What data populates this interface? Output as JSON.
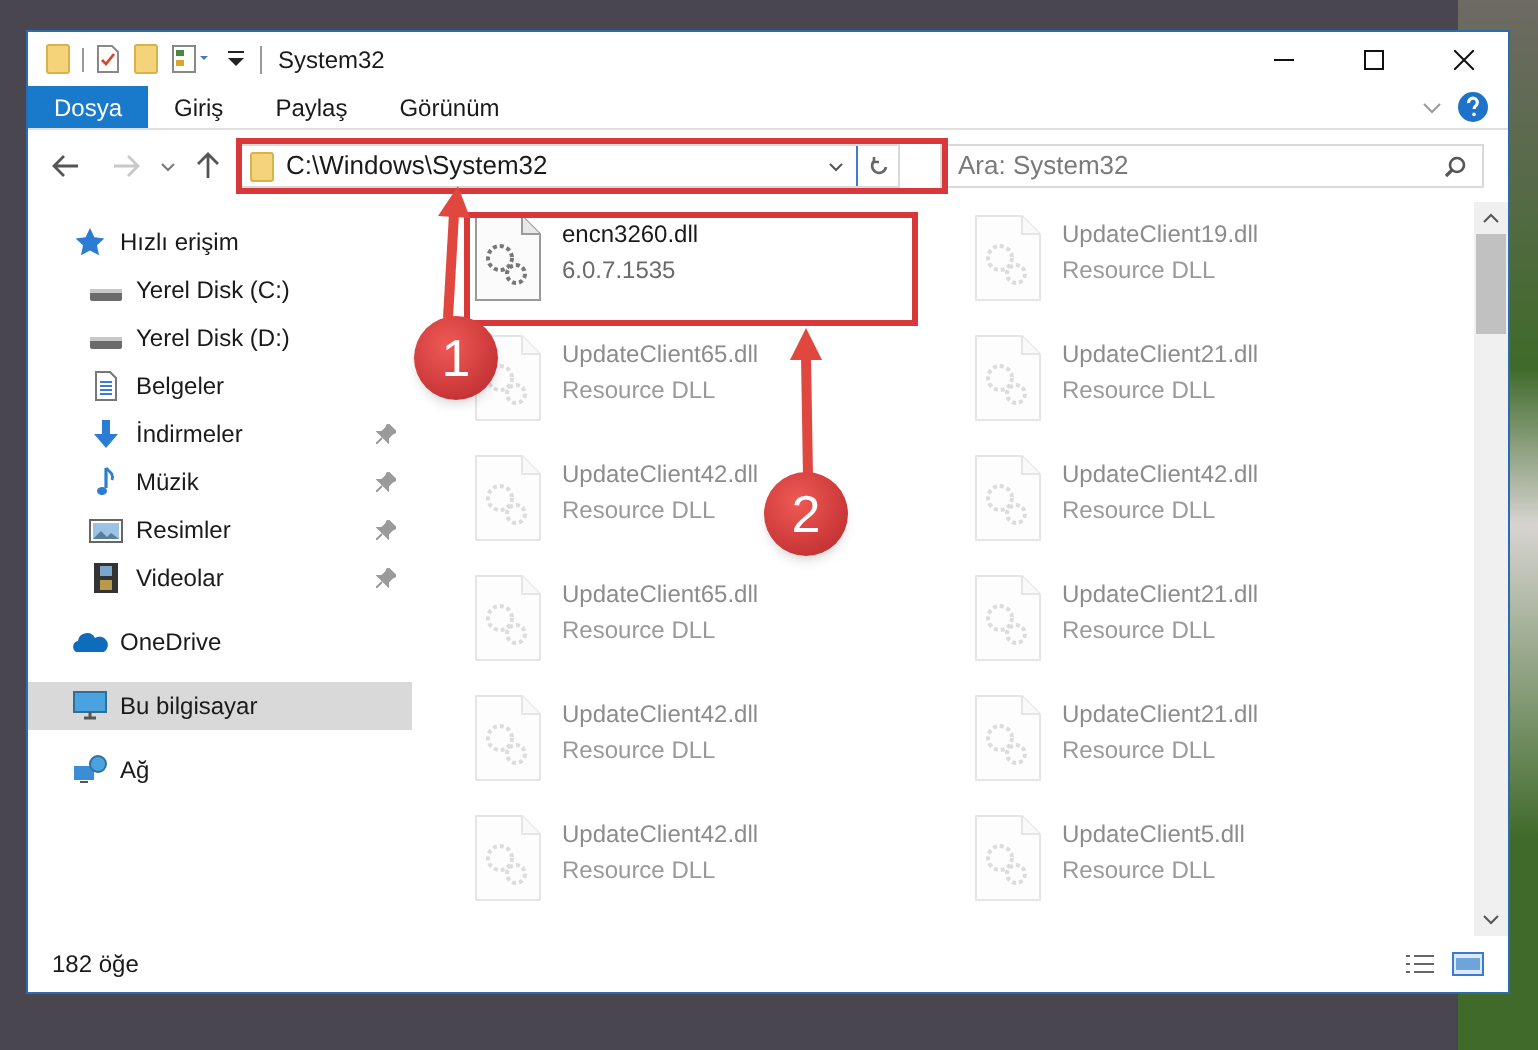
{
  "window": {
    "title": "System32"
  },
  "ribbon_tabs": [
    {
      "label": "Dosya",
      "selected": true
    },
    {
      "label": "Giriş",
      "selected": false
    },
    {
      "label": "Paylaş",
      "selected": false
    },
    {
      "label": "Görünüm",
      "selected": false
    }
  ],
  "address_bar": {
    "path": "C:\\Windows\\System32"
  },
  "search": {
    "placeholder": "Ara: System32"
  },
  "sidebar": {
    "items": [
      {
        "label": "Hızlı erişim",
        "kind": "star",
        "pinned": false,
        "selected": false,
        "group": true
      },
      {
        "label": "Yerel Disk (C:)",
        "kind": "drive",
        "pinned": false,
        "selected": false,
        "group": false
      },
      {
        "label": "Yerel Disk (D:)",
        "kind": "drive",
        "pinned": false,
        "selected": false,
        "group": false
      },
      {
        "label": "Belgeler",
        "kind": "document",
        "pinned": false,
        "selected": false,
        "group": false
      },
      {
        "label": "İndirmeler",
        "kind": "download",
        "pinned": true,
        "selected": false,
        "group": false
      },
      {
        "label": "Müzik",
        "kind": "music",
        "pinned": true,
        "selected": false,
        "group": false
      },
      {
        "label": "Resimler",
        "kind": "pictures",
        "pinned": true,
        "selected": false,
        "group": false
      },
      {
        "label": "Videolar",
        "kind": "video",
        "pinned": true,
        "selected": false,
        "group": false
      },
      {
        "label": "OneDrive",
        "kind": "cloud",
        "pinned": false,
        "selected": false,
        "group": true
      },
      {
        "label": "Bu bilgisayar",
        "kind": "computer",
        "pinned": false,
        "selected": true,
        "group": true
      },
      {
        "label": "Ağ",
        "kind": "network",
        "pinned": false,
        "selected": false,
        "group": true
      }
    ]
  },
  "files": [
    {
      "name": "encn3260.dll",
      "detail": "6.0.7.1535",
      "faded": false
    },
    {
      "name": "UpdateClient19.dll",
      "detail": "Resource DLL",
      "faded": true
    },
    {
      "name": "UpdateClient65.dll",
      "detail": "Resource DLL",
      "faded": true
    },
    {
      "name": "UpdateClient21.dll",
      "detail": "Resource DLL",
      "faded": true
    },
    {
      "name": "UpdateClient42.dll",
      "detail": "Resource DLL",
      "faded": true
    },
    {
      "name": "UpdateClient42.dll",
      "detail": "Resource DLL",
      "faded": true
    },
    {
      "name": "UpdateClient65.dll",
      "detail": "Resource DLL",
      "faded": true
    },
    {
      "name": "UpdateClient21.dll",
      "detail": "Resource DLL",
      "faded": true
    },
    {
      "name": "UpdateClient42.dll",
      "detail": "Resource DLL",
      "faded": true
    },
    {
      "name": "UpdateClient21.dll",
      "detail": "Resource DLL",
      "faded": true
    },
    {
      "name": "UpdateClient42.dll",
      "detail": "Resource DLL",
      "faded": true
    },
    {
      "name": "UpdateClient5.dll",
      "detail": "Resource DLL",
      "faded": true
    }
  ],
  "status_bar": {
    "count": "182 öğe"
  },
  "annotations": [
    {
      "label": "1"
    },
    {
      "label": "2"
    }
  ]
}
